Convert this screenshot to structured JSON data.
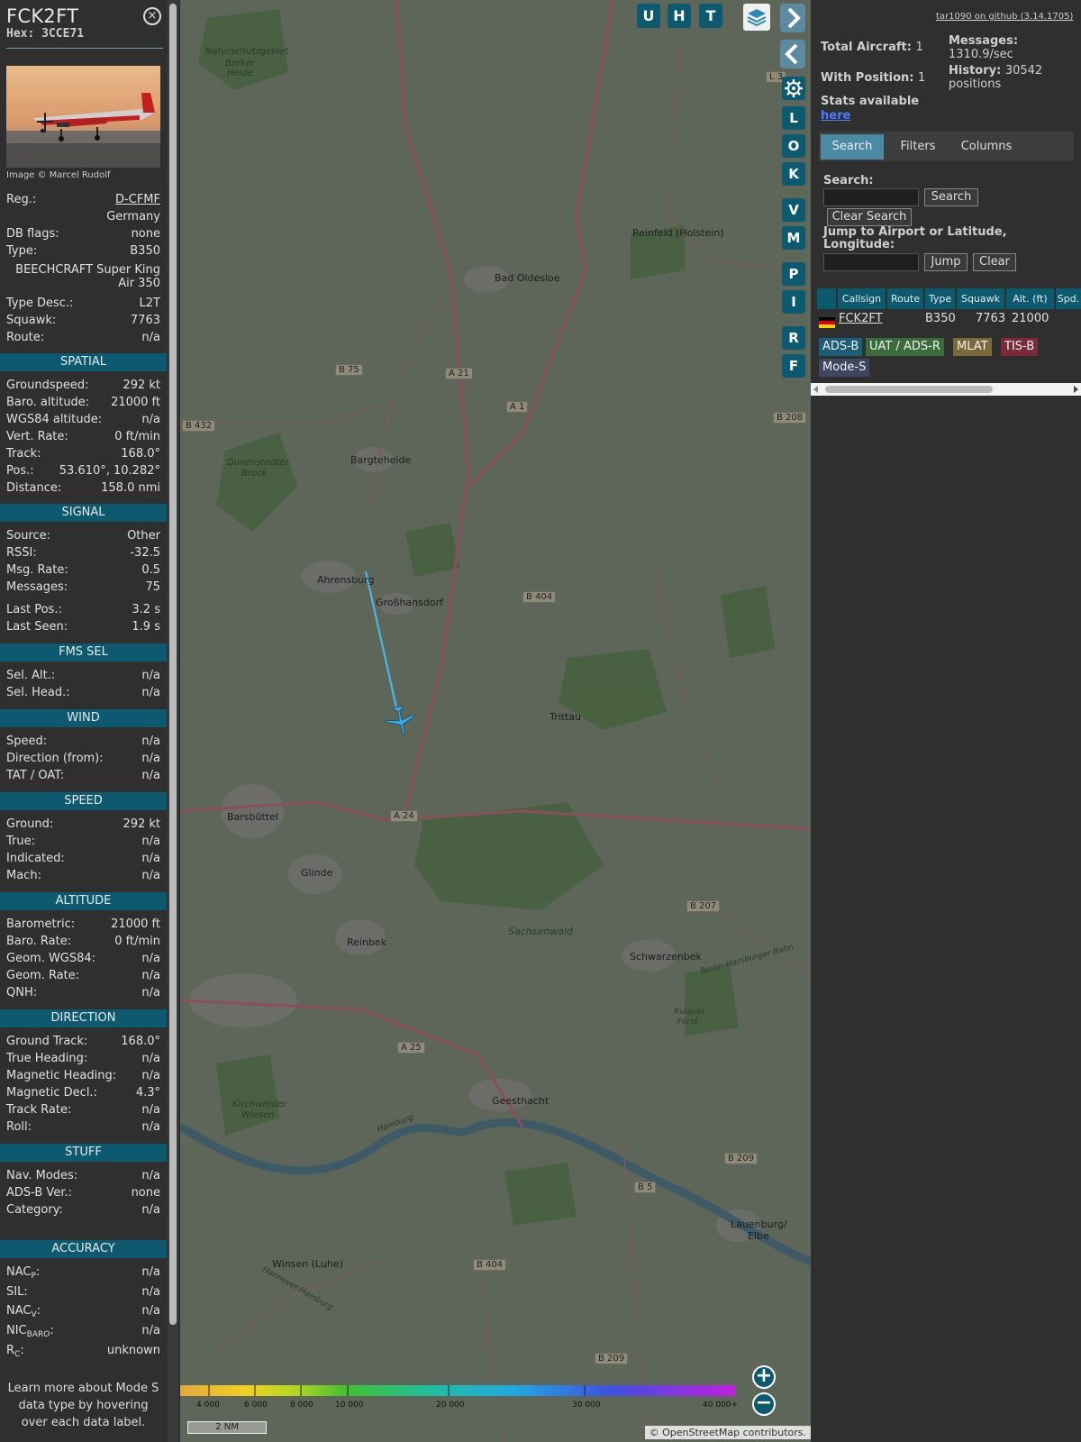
{
  "info": {
    "callsign": "FCK2FT",
    "hex": "Hex: 3CCE71",
    "close_icon": "×",
    "photo_credit": "Image © Marcel Rudolf",
    "reg_label": "Reg.:",
    "reg": "D-CFMF",
    "country": "Germany",
    "dbflags_label": "DB flags:",
    "dbflags": "none",
    "type_label": "Type:",
    "type": "B350",
    "type_full_1": "BEECHCRAFT Super King",
    "type_full_2": "Air 350",
    "typedesc_label": "Type Desc.:",
    "typedesc": "L2T",
    "squawk_label": "Squawk:",
    "squawk": "7763",
    "route_label": "Route:",
    "route": "n/a",
    "sections": {
      "spatial": "SPATIAL",
      "signal": "SIGNAL",
      "fmssel": "FMS SEL",
      "wind": "WIND",
      "speed": "SPEED",
      "altitude": "ALTITUDE",
      "direction": "DIRECTION",
      "stuff": "STUFF",
      "accuracy": "ACCURACY"
    },
    "spatial": [
      [
        "Groundspeed:",
        "292 kt"
      ],
      [
        "Baro. altitude:",
        "21000 ft"
      ],
      [
        "WGS84 altitude:",
        "n/a"
      ],
      [
        "Vert. Rate:",
        "0 ft/min"
      ],
      [
        "Track:",
        "168.0°"
      ],
      [
        "Pos.:",
        "53.610°, 10.282°"
      ],
      [
        "Distance:",
        "158.0 nmi"
      ]
    ],
    "signal": [
      [
        "Source:",
        "Other"
      ],
      [
        "RSSI:",
        "-32.5"
      ],
      [
        "Msg. Rate:",
        "0.5"
      ],
      [
        "Messages:",
        "75"
      ],
      [
        "Last Pos.:",
        "3.2 s"
      ],
      [
        "Last Seen:",
        "1.9 s"
      ]
    ],
    "fmssel": [
      [
        "Sel. Alt.:",
        "n/a"
      ],
      [
        "Sel. Head.:",
        "n/a"
      ]
    ],
    "wind": [
      [
        "Speed:",
        "n/a"
      ],
      [
        "Direction (from):",
        "n/a"
      ],
      [
        "TAT / OAT:",
        "n/a"
      ]
    ],
    "speed": [
      [
        "Ground:",
        "292 kt"
      ],
      [
        "True:",
        "n/a"
      ],
      [
        "Indicated:",
        "n/a"
      ],
      [
        "Mach:",
        "n/a"
      ]
    ],
    "altitude": [
      [
        "Barometric:",
        "21000 ft"
      ],
      [
        "Baro. Rate:",
        "0 ft/min"
      ],
      [
        "Geom. WGS84:",
        "n/a"
      ],
      [
        "Geom. Rate:",
        "n/a"
      ],
      [
        "QNH:",
        "n/a"
      ]
    ],
    "direction": [
      [
        "Ground Track:",
        "168.0°"
      ],
      [
        "True Heading:",
        "n/a"
      ],
      [
        "Magnetic Heading:",
        "n/a"
      ],
      [
        "Magnetic Decl.:",
        "4.3°"
      ],
      [
        "Track Rate:",
        "n/a"
      ],
      [
        "Roll:",
        "n/a"
      ]
    ],
    "stuff": [
      [
        "Nav. Modes:",
        "n/a"
      ],
      [
        "ADS-B Ver.:",
        "none"
      ],
      [
        "Category:",
        "n/a"
      ]
    ],
    "accuracy": {
      "nacp_k": "NAC",
      "nacp_sub": "P",
      "nacp": "n/a",
      "sil_k": "SIL:",
      "sil": "n/a",
      "nacv_k": "NAC",
      "nacv_sub": "V",
      "nacv": "n/a",
      "nicbaro_k": "NIC",
      "nicbaro_sub": "BARO",
      "nicbaro": "n/a",
      "rc_k": "R",
      "rc_sub": "C",
      "rc": "unknown"
    },
    "learn_more": "Learn more about Mode S data type by hovering over each data label."
  },
  "map": {
    "top_buttons": [
      "U",
      "H",
      "T"
    ],
    "side_buttons": [
      "L",
      "O",
      "K",
      "V",
      "M",
      "P",
      "I",
      "R",
      "F"
    ],
    "layers_icon": "layers-icon",
    "settings_icon": "gear-icon",
    "places": [
      [
        "Naturschutzgebiet",
        1
      ],
      [
        "Borker",
        0
      ],
      [
        "Heide",
        0
      ],
      [
        "Reinfeld (Holstein)",
        0
      ],
      [
        "Bad Oldesloe",
        0
      ],
      [
        "Bargteheide",
        0
      ],
      [
        "Duvenstedter",
        0
      ],
      [
        "Brook",
        0
      ],
      [
        "Ahrensburg",
        0
      ],
      [
        "Großhansdorf",
        0
      ],
      [
        "Trittau",
        0
      ],
      [
        "Barsbüttel",
        0
      ],
      [
        "Glinde",
        0
      ],
      [
        "Reinbek",
        0
      ],
      [
        "Sachsenwald",
        0
      ],
      [
        "Schwarzenbek",
        0
      ],
      [
        "Geesthacht",
        0
      ],
      [
        "Kirchwerder",
        0
      ],
      [
        "Wiesen",
        0
      ],
      [
        "Winsen (Luhe)",
        0
      ],
      [
        "Lauenburg/",
        0
      ],
      [
        "Elbe",
        0
      ],
      [
        "Rulauer",
        0
      ],
      [
        "Forst",
        0
      ],
      [
        "Hamburg",
        0
      ],
      [
        "Berlin-Hamburger Bahn",
        0
      ],
      [
        "Hannover-Hamburg",
        0
      ]
    ],
    "shields": [
      "B 75",
      "A 21",
      "A 1",
      "B 432",
      "B 208",
      "B 404",
      "A 24",
      "B 207",
      "A 25",
      "B 209",
      "B 5",
      "B 404",
      "B 209",
      "L 3"
    ],
    "alt_legend": [
      "4 000",
      "6 000",
      "8 000",
      "10 000",
      "20 000",
      "30 000",
      "40 000+"
    ],
    "scale": "2 NM",
    "attribution": "© OpenStreetMap contributors."
  },
  "right": {
    "github": "tar1090 on github (3.14.1705)",
    "total_aircraft_label": "Total Aircraft:",
    "total_aircraft": "1",
    "with_position_label": "With Position:",
    "with_position": "1",
    "messages_label": "Messages:",
    "messages": "1310.9/sec",
    "history_label": "History:",
    "history": "30542",
    "history_unit": "positions",
    "stats_label": "Stats available",
    "stats_link": "here",
    "tabs": [
      "Search",
      "Filters",
      "Columns"
    ],
    "search_label": "Search:",
    "search_btn": "Search",
    "clear_search_btn": "Clear Search",
    "jump_label_1": "Jump to Airport or Latitude,",
    "jump_label_2": "Longitude:",
    "jump_btn": "Jump",
    "clear_btn": "Clear",
    "columns": [
      "Callsign",
      "Route",
      "Type",
      "Squawk",
      "Alt. (ft)",
      "Spd."
    ],
    "row": {
      "callsign": "FCK2FT",
      "route": "",
      "type": "B350",
      "squawk": "7763",
      "alt": "21000"
    },
    "chips": [
      {
        "label": "ADS-B",
        "color": "#1c5d77"
      },
      {
        "label": "UAT / ADS-R",
        "color": "#3a6b3d"
      },
      {
        "label": "MLAT",
        "color": "#7a6a3a"
      },
      {
        "label": "TIS-B",
        "color": "#7a2a3a"
      },
      {
        "label": "Mode-S",
        "color": "#3e4660"
      }
    ]
  }
}
